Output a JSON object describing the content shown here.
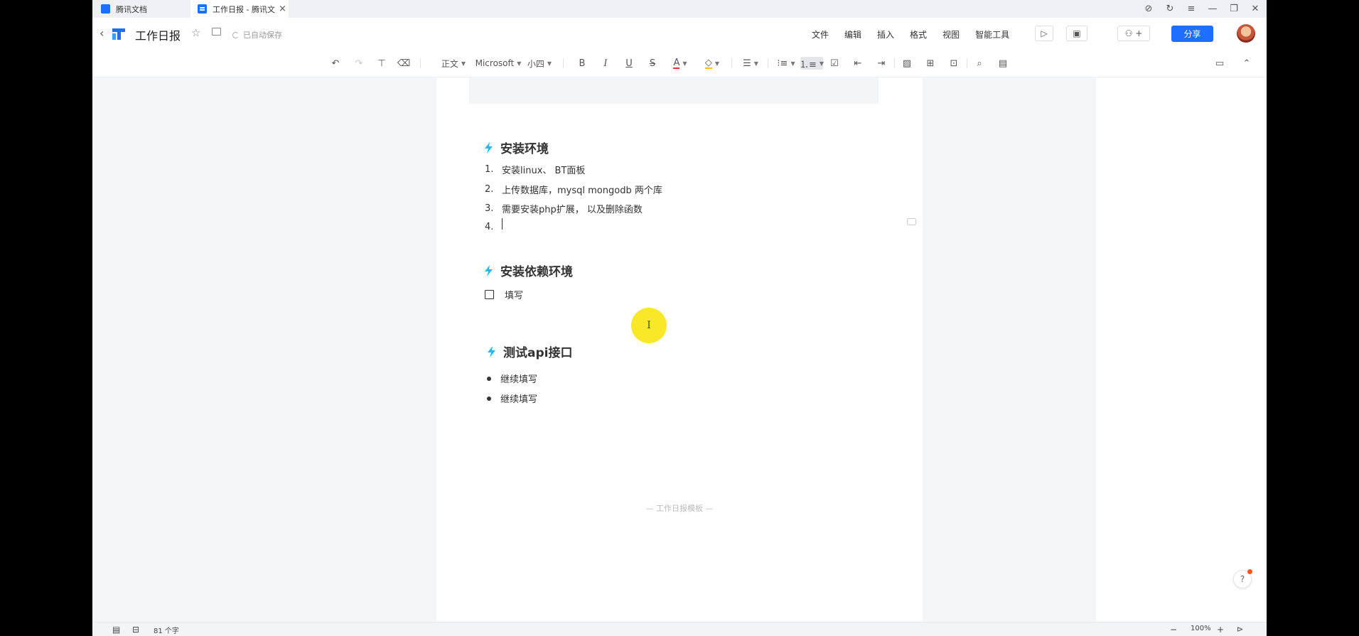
{
  "tabs": [
    {
      "label": "腾讯文档",
      "icon": "tencent-docs-icon"
    },
    {
      "label": "工作日报 - 腾讯文",
      "icon": "document-icon",
      "active": true
    }
  ],
  "window_controls": {
    "icons": [
      "compass-icon",
      "refresh-icon",
      "menu-icon",
      "minimize-icon",
      "restore-icon",
      "close-icon"
    ]
  },
  "header": {
    "title": "工作日报",
    "save_status": "已自动保存",
    "menus": [
      "文件",
      "编辑",
      "插入",
      "格式",
      "视图",
      "智能工具"
    ],
    "share_label": "分享",
    "accent": "#1e6fff"
  },
  "toolbar": {
    "style": "正文",
    "font": "Microsoft",
    "size": "小四",
    "bold": "B",
    "italic": "I",
    "underline": "U",
    "strike": "S",
    "color_a": "A"
  },
  "doc": {
    "sections": [
      {
        "heading": "安装环境"
      },
      {
        "heading": "安装依赖环境"
      },
      {
        "heading": "测试api接口"
      }
    ],
    "ordered": [
      {
        "num": "1.",
        "text": "安装linux、 BT面板"
      },
      {
        "num": "2.",
        "text": "上传数据库，mysql mongodb 两个库"
      },
      {
        "num": "3.",
        "text": "需要安装php扩展， 以及删除函数"
      },
      {
        "num": "4.",
        "text": ""
      }
    ],
    "checklist": [
      {
        "text": "填写",
        "checked": false
      }
    ],
    "bullets": [
      {
        "text": "继续填写"
      },
      {
        "text": "继续填写"
      }
    ],
    "footer": "— 工作日报模板 —"
  },
  "cursor_glyph": "I",
  "help_label": "?",
  "status": {
    "word_count": "81 个字",
    "zoom": "100%",
    "minus": "−",
    "plus": "+"
  }
}
